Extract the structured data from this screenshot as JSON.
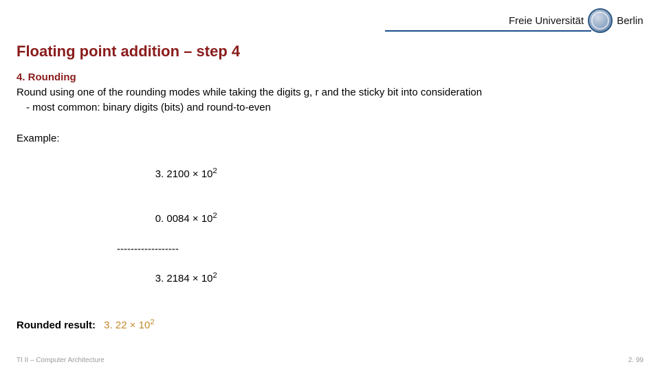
{
  "brand": {
    "left": "Freie Universität",
    "right": "Berlin"
  },
  "title": "Floating point addition – step 4",
  "step": {
    "label": "4. Rounding",
    "desc": "Round using one of the rounding modes while taking the digits g, r and the sticky bit into consideration",
    "note": "- most common: binary digits (bits) and round-to-even"
  },
  "example": {
    "label": "Example:",
    "rows": {
      "a": {
        "mant": "3. 2100 ",
        "mult": "×",
        "base": " 10",
        "exp": "2"
      },
      "b": {
        "mant": "0. 0084 ",
        "mult": "×",
        "base": " 10",
        "exp": "2"
      },
      "dashes": "------------------",
      "sum": {
        "mant": "3. 2184 ",
        "mult": "×",
        "base": " 10",
        "exp": "2"
      }
    }
  },
  "rounded": {
    "label": "Rounded result:",
    "mant": "3. 22 ",
    "mult": "×",
    "base": " 10",
    "exp": "2"
  },
  "footer": {
    "left": "TI II – Computer Architecture",
    "right": "2. 99"
  }
}
